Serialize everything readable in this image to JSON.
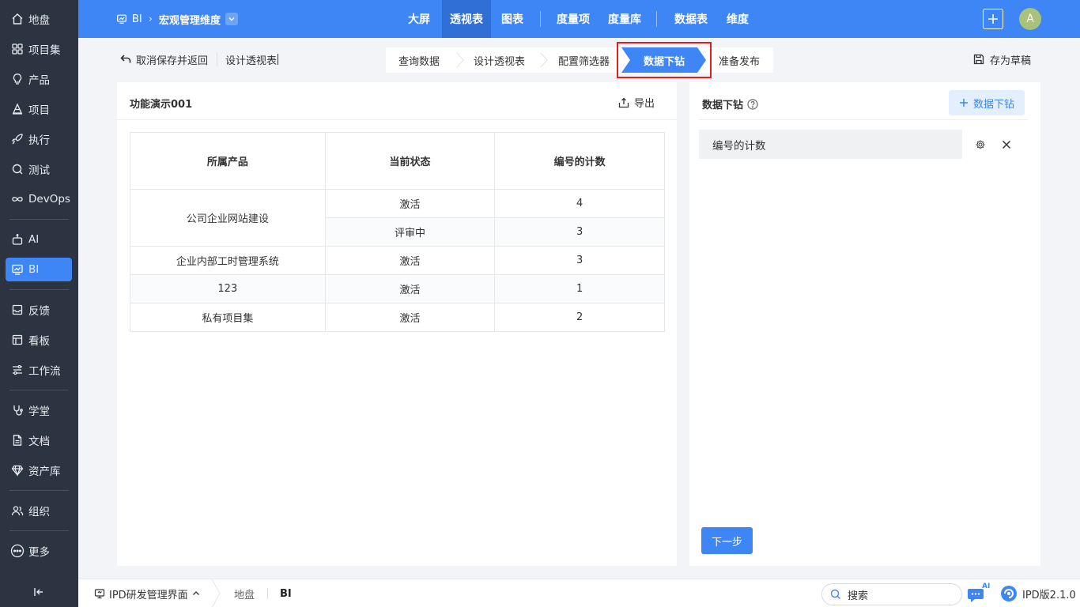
{
  "sidebar": {
    "items": [
      {
        "label": "地盘",
        "icon": "home-icon"
      },
      {
        "label": "项目集",
        "icon": "grid-icon"
      },
      {
        "label": "产品",
        "icon": "bulb-icon"
      },
      {
        "label": "项目",
        "icon": "cone-icon"
      },
      {
        "label": "执行",
        "icon": "rocket-icon"
      },
      {
        "label": "测试",
        "icon": "search-icon"
      },
      {
        "label": "DevOps",
        "icon": "infinity-icon"
      },
      {
        "label": "AI",
        "icon": "robot-icon"
      },
      {
        "label": "BI",
        "icon": "chart-icon",
        "active": true
      },
      {
        "label": "反馈",
        "icon": "inbox-icon"
      },
      {
        "label": "看板",
        "icon": "board-icon"
      },
      {
        "label": "工作流",
        "icon": "flow-icon"
      },
      {
        "label": "学堂",
        "icon": "stethoscope-icon"
      },
      {
        "label": "文档",
        "icon": "document-icon"
      },
      {
        "label": "资产库",
        "icon": "diamond-icon"
      },
      {
        "label": "组织",
        "icon": "people-icon"
      },
      {
        "label": "更多",
        "icon": "more-icon"
      }
    ]
  },
  "topbar": {
    "module": "BI",
    "current": "宏观管理维度",
    "nav": [
      "大屏",
      "透视表",
      "图表",
      "度量项",
      "度量库",
      "数据表",
      "维度"
    ],
    "active_nav": "透视表",
    "avatar": "A"
  },
  "toolbar": {
    "back_label": "取消保存并返回",
    "design_name": "设计透视表",
    "steps": [
      "查询数据",
      "设计透视表",
      "配置筛选器",
      "数据下钻",
      "准备发布"
    ],
    "active_step": "数据下钻",
    "save_draft": "存为草稿"
  },
  "left_panel": {
    "title": "功能演示001",
    "export_label": "导出",
    "table": {
      "headers": [
        "所属产品",
        "当前状态",
        "编号的计数"
      ],
      "rows": [
        {
          "product": "公司企业网站建设",
          "status": "激活",
          "count": "4"
        },
        {
          "product": "",
          "status": "评审中",
          "count": "3"
        },
        {
          "product": "企业内部工时管理系统",
          "status": "激活",
          "count": "3"
        },
        {
          "product": "123",
          "status": "激活",
          "count": "1"
        },
        {
          "product": "私有项目集",
          "status": "激活",
          "count": "2"
        }
      ]
    }
  },
  "right_panel": {
    "title": "数据下钻",
    "add_label": "数据下钻",
    "items": [
      "编号的计数"
    ],
    "next_label": "下一步"
  },
  "bottombar": {
    "home_label": "IPD研发管理界面",
    "tabs": [
      "地盘",
      "BI"
    ],
    "active_tab": "BI",
    "search_placeholder": "搜索",
    "version": "IPD版2.1.0",
    "ai_badge": "AI"
  },
  "colors": {
    "primary": "#3e86f5",
    "sidebar_bg": "#2d3441",
    "highlight_border": "#e02020"
  }
}
